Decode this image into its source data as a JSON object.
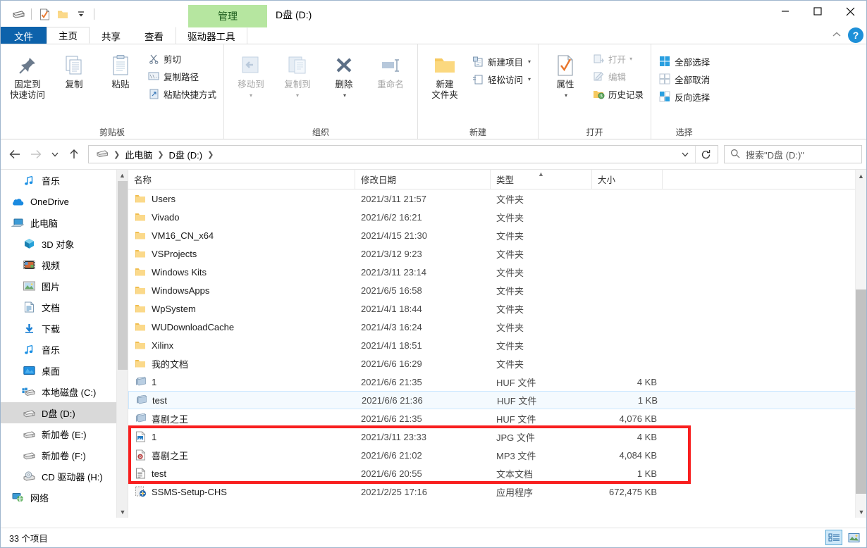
{
  "window": {
    "title": "D盘 (D:)",
    "contextual_tab_header": "管理",
    "quick_access": [
      {
        "name": "drive-icon",
        "label": "D盘 (D:)"
      },
      {
        "name": "properties-icon",
        "label": "属性"
      },
      {
        "name": "new-folder-icon",
        "label": "新建文件夹"
      },
      {
        "name": "customize-qat-icon",
        "label": "自定义快速访问工具栏"
      }
    ],
    "controls": {
      "minimize": "—",
      "maximize": "□",
      "close": "✕",
      "collapse_ribbon": "^",
      "help": "?"
    }
  },
  "tabs": [
    {
      "label": "文件",
      "style": "file"
    },
    {
      "label": "主页",
      "style": "active"
    },
    {
      "label": "共享",
      "style": "normal"
    },
    {
      "label": "查看",
      "style": "normal"
    },
    {
      "label": "驱动器工具",
      "style": "contextual"
    }
  ],
  "ribbon": {
    "groups": [
      {
        "label": "剪贴板",
        "big": [
          {
            "label1": "固定到",
            "label2": "快速访问",
            "icon": "pin-icon",
            "disabled": false
          },
          {
            "label1": "复制",
            "label2": "",
            "icon": "copy-icon",
            "disabled": false
          },
          {
            "label1": "粘贴",
            "label2": "",
            "icon": "paste-icon",
            "disabled": false
          }
        ],
        "small": [
          {
            "label": "剪切",
            "icon": "scissors-icon"
          },
          {
            "label": "复制路径",
            "icon": "copy-path-icon"
          },
          {
            "label": "粘贴快捷方式",
            "icon": "paste-shortcut-icon"
          }
        ]
      },
      {
        "label": "组织",
        "big": [
          {
            "label1": "移动到",
            "label2": "",
            "icon": "move-to-icon",
            "disabled": true,
            "caret": true
          },
          {
            "label1": "复制到",
            "label2": "",
            "icon": "copy-to-icon",
            "disabled": true,
            "caret": true
          },
          {
            "label1": "删除",
            "label2": "",
            "icon": "delete-icon",
            "disabled": false,
            "caret": true
          },
          {
            "label1": "重命名",
            "label2": "",
            "icon": "rename-icon",
            "disabled": true
          }
        ],
        "small": []
      },
      {
        "label": "新建",
        "big": [
          {
            "label1": "新建",
            "label2": "文件夹",
            "icon": "new-folder-icon",
            "disabled": false
          }
        ],
        "small": [
          {
            "label": "新建项目",
            "icon": "new-item-icon",
            "caret": true
          },
          {
            "label": "轻松访问",
            "icon": "easy-access-icon",
            "caret": true
          }
        ]
      },
      {
        "label": "打开",
        "big": [
          {
            "label1": "属性",
            "label2": "",
            "icon": "properties-icon",
            "disabled": false,
            "caret": true
          }
        ],
        "small": [
          {
            "label": "打开",
            "icon": "open-icon",
            "caret": true,
            "disabled": true
          },
          {
            "label": "编辑",
            "icon": "edit-icon",
            "disabled": true
          },
          {
            "label": "历史记录",
            "icon": "history-icon"
          }
        ]
      },
      {
        "label": "选择",
        "big": [],
        "small": [
          {
            "label": "全部选择",
            "icon": "select-all-icon"
          },
          {
            "label": "全部取消",
            "icon": "select-none-icon"
          },
          {
            "label": "反向选择",
            "icon": "invert-selection-icon"
          }
        ]
      }
    ]
  },
  "address": {
    "back": "←",
    "forward": "→",
    "recent": "⌄",
    "up": "↑",
    "crumbs": [
      "此电脑",
      "D盘 (D:)"
    ],
    "refresh": "↻",
    "dropdown": "⌄"
  },
  "search": {
    "placeholder": "搜索\"D盘 (D:)\"",
    "icon": "search-icon"
  },
  "sidebar": {
    "items": [
      {
        "label": "音乐",
        "icon": "music-icon",
        "indent": 1,
        "selected": false
      },
      {
        "label": "OneDrive",
        "icon": "onedrive-icon",
        "indent": 0,
        "selected": false
      },
      {
        "label": "此电脑",
        "icon": "this-pc-icon",
        "indent": 0,
        "selected": false
      },
      {
        "label": "3D 对象",
        "icon": "3d-objects-icon",
        "indent": 1,
        "selected": false
      },
      {
        "label": "视频",
        "icon": "videos-icon",
        "indent": 1,
        "selected": false
      },
      {
        "label": "图片",
        "icon": "pictures-icon",
        "indent": 1,
        "selected": false
      },
      {
        "label": "文档",
        "icon": "documents-icon",
        "indent": 1,
        "selected": false
      },
      {
        "label": "下载",
        "icon": "downloads-icon",
        "indent": 1,
        "selected": false
      },
      {
        "label": "音乐",
        "icon": "music-icon",
        "indent": 1,
        "selected": false
      },
      {
        "label": "桌面",
        "icon": "desktop-icon",
        "indent": 1,
        "selected": false
      },
      {
        "label": "本地磁盘 (C:)",
        "icon": "windows-drive-icon",
        "indent": 1,
        "selected": false
      },
      {
        "label": "D盘 (D:)",
        "icon": "drive-icon",
        "indent": 1,
        "selected": true
      },
      {
        "label": "新加卷 (E:)",
        "icon": "drive-icon",
        "indent": 1,
        "selected": false
      },
      {
        "label": "新加卷 (F:)",
        "icon": "drive-icon",
        "indent": 1,
        "selected": false
      },
      {
        "label": "CD 驱动器 (H:)",
        "icon": "cd-drive-icon",
        "indent": 1,
        "selected": false
      },
      {
        "label": "网络",
        "icon": "network-icon",
        "indent": 0,
        "selected": false
      }
    ]
  },
  "filelist": {
    "columns": [
      {
        "label": "名称",
        "sorted": false
      },
      {
        "label": "修改日期",
        "sorted": false
      },
      {
        "label": "类型",
        "sorted": true,
        "sort_dir": "asc"
      },
      {
        "label": "大小",
        "sorted": false
      }
    ],
    "rows": [
      {
        "name": "Users",
        "date": "2021/3/11 21:57",
        "type": "文件夹",
        "size": "",
        "icon": "folder-icon",
        "focused": false
      },
      {
        "name": "Vivado",
        "date": "2021/6/2 16:21",
        "type": "文件夹",
        "size": "",
        "icon": "folder-icon",
        "focused": false
      },
      {
        "name": "VM16_CN_x64",
        "date": "2021/4/15 21:30",
        "type": "文件夹",
        "size": "",
        "icon": "folder-icon",
        "focused": false
      },
      {
        "name": "VSProjects",
        "date": "2021/3/12 9:23",
        "type": "文件夹",
        "size": "",
        "icon": "folder-icon",
        "focused": false
      },
      {
        "name": "Windows Kits",
        "date": "2021/3/11 23:14",
        "type": "文件夹",
        "size": "",
        "icon": "folder-icon",
        "focused": false
      },
      {
        "name": "WindowsApps",
        "date": "2021/6/5 16:58",
        "type": "文件夹",
        "size": "",
        "icon": "folder-icon",
        "focused": false
      },
      {
        "name": "WpSystem",
        "date": "2021/4/1 18:44",
        "type": "文件夹",
        "size": "",
        "icon": "folder-icon",
        "focused": false
      },
      {
        "name": "WUDownloadCache",
        "date": "2021/4/3 16:24",
        "type": "文件夹",
        "size": "",
        "icon": "folder-icon",
        "focused": false
      },
      {
        "name": "Xilinx",
        "date": "2021/4/1 18:51",
        "type": "文件夹",
        "size": "",
        "icon": "folder-icon",
        "focused": false
      },
      {
        "name": "我的文档",
        "date": "2021/6/6 16:29",
        "type": "文件夹",
        "size": "",
        "icon": "folder-icon",
        "focused": false
      },
      {
        "name": "1",
        "date": "2021/6/6 21:35",
        "type": "HUF 文件",
        "size": "4 KB",
        "icon": "huf-file-icon",
        "focused": false
      },
      {
        "name": "test",
        "date": "2021/6/6 21:36",
        "type": "HUF 文件",
        "size": "1 KB",
        "icon": "huf-file-icon",
        "focused": true
      },
      {
        "name": "喜剧之王",
        "date": "2021/6/6 21:35",
        "type": "HUF 文件",
        "size": "4,076 KB",
        "icon": "huf-file-icon",
        "focused": false
      },
      {
        "name": "1",
        "date": "2021/3/11 23:33",
        "type": "JPG 文件",
        "size": "4 KB",
        "icon": "jpg-file-icon",
        "focused": false
      },
      {
        "name": "喜剧之王",
        "date": "2021/6/6 21:02",
        "type": "MP3 文件",
        "size": "4,084 KB",
        "icon": "mp3-file-icon",
        "focused": false
      },
      {
        "name": "test",
        "date": "2021/6/6 20:55",
        "type": "文本文档",
        "size": "1 KB",
        "icon": "text-file-icon",
        "focused": false
      },
      {
        "name": "SSMS-Setup-CHS",
        "date": "2021/2/25 17:16",
        "type": "应用程序",
        "size": "672,475 KB",
        "icon": "exe-file-icon",
        "focused": false
      }
    ]
  },
  "annotation": {
    "color": "#f81f1f",
    "highlighted_rows": [
      "1",
      "喜剧之王",
      "test"
    ]
  },
  "statusbar": {
    "item_count": "33 个项目",
    "views": [
      {
        "name": "details-view-button",
        "active": true
      },
      {
        "name": "large-icons-view-button",
        "active": false
      }
    ]
  }
}
